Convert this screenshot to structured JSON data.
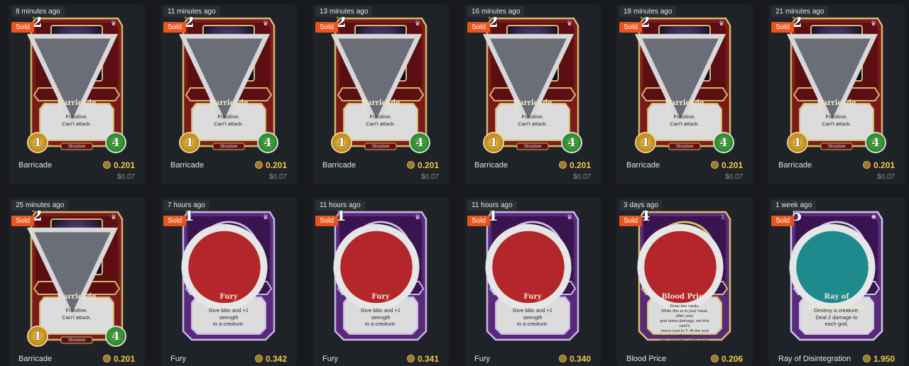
{
  "colors": {
    "page_bg": "#17191c",
    "tile_bg": "#1f2226",
    "sold_badge": "#e8541e",
    "price": "#f2c94c",
    "usd": "#8e8f91"
  },
  "listings": [
    {
      "time": "8 minutes ago",
      "badge": "Sold",
      "card": {
        "name": "Barricade",
        "text": "Frontline.\nCan't attack.",
        "type": "Structure",
        "mana": "2",
        "attack": "1",
        "health": "4",
        "style": "barricade",
        "god_icon": "war-god-icon"
      },
      "name": "Barricade",
      "price": "0.201",
      "usd": "$0.07"
    },
    {
      "time": "11 minutes ago",
      "badge": "Sold",
      "card": {
        "name": "Barricade",
        "text": "Frontline.\nCan't attack.",
        "type": "Structure",
        "mana": "2",
        "attack": "1",
        "health": "4",
        "style": "barricade",
        "god_icon": "war-god-icon"
      },
      "name": "Barricade",
      "price": "0.201",
      "usd": "$0.07"
    },
    {
      "time": "13 minutes ago",
      "badge": "Sold",
      "card": {
        "name": "Barricade",
        "text": "Frontline.\nCan't attack.",
        "type": "Structure",
        "mana": "2",
        "attack": "1",
        "health": "4",
        "style": "barricade",
        "god_icon": "war-god-icon"
      },
      "name": "Barricade",
      "price": "0.201",
      "usd": "$0.07"
    },
    {
      "time": "16 minutes ago",
      "badge": "Sold",
      "card": {
        "name": "Barricade",
        "text": "Frontline.\nCan't attack.",
        "type": "Structure",
        "mana": "2",
        "attack": "1",
        "health": "4",
        "style": "barricade",
        "god_icon": "war-god-icon"
      },
      "name": "Barricade",
      "price": "0.201",
      "usd": "$0.07"
    },
    {
      "time": "18 minutes ago",
      "badge": "Sold",
      "card": {
        "name": "Barricade",
        "text": "Frontline.\nCan't attack.",
        "type": "Structure",
        "mana": "2",
        "attack": "1",
        "health": "4",
        "style": "barricade",
        "god_icon": "war-god-icon"
      },
      "name": "Barricade",
      "price": "0.201",
      "usd": "$0.07"
    },
    {
      "time": "21 minutes ago",
      "badge": "Sold",
      "card": {
        "name": "Barricade",
        "text": "Frontline.\nCan't attack.",
        "type": "Structure",
        "mana": "2",
        "attack": "1",
        "health": "4",
        "style": "barricade",
        "god_icon": "war-god-icon"
      },
      "name": "Barricade",
      "price": "0.201",
      "usd": "$0.07"
    },
    {
      "time": "25 minutes ago",
      "badge": "Sold",
      "card": {
        "name": "Barricade",
        "text": "Frontline.\nCan't attack.",
        "type": "Structure",
        "mana": "2",
        "attack": "1",
        "health": "4",
        "style": "barricade",
        "god_icon": "war-god-icon"
      },
      "name": "Barricade",
      "price": "0.201",
      "usd": ""
    },
    {
      "time": "7 hours ago",
      "badge": "Sold",
      "card": {
        "name": "Fury",
        "text": "Give blitz and +1 strength\nto a creature.",
        "type": "",
        "mana": "1",
        "attack": "",
        "health": "",
        "style": "spell-red",
        "god_icon": "war-god-icon"
      },
      "name": "Fury",
      "price": "0.342",
      "usd": ""
    },
    {
      "time": "11 hours ago",
      "badge": "Sold",
      "card": {
        "name": "Fury",
        "text": "Give blitz and +1 strength\nto a creature.",
        "type": "",
        "mana": "1",
        "attack": "",
        "health": "",
        "style": "spell-red",
        "god_icon": "war-god-icon"
      },
      "name": "Fury",
      "price": "0.341",
      "usd": ""
    },
    {
      "time": "11 hours ago",
      "badge": "Sold",
      "card": {
        "name": "Fury",
        "text": "Give blitz and +1 strength\nto a creature.",
        "type": "",
        "mana": "1",
        "attack": "",
        "health": "",
        "style": "spell-red",
        "god_icon": "war-god-icon"
      },
      "name": "Fury",
      "price": "0.340",
      "usd": ""
    },
    {
      "time": "3 days ago",
      "badge": "Sold",
      "card": {
        "name": "Blood Price",
        "text": "Draw two cards.\nWhile this is in your hand, after your\ngod takes damage, set this card's\nmana cost to 2. At the end of your\nturn, reset this card's mana cost.",
        "type": "",
        "mana": "4",
        "attack": "",
        "health": "",
        "style": "spell-gold",
        "god_icon": "death-god-icon"
      },
      "name": "Blood Price",
      "price": "0.206",
      "usd": ""
    },
    {
      "time": "1 week ago",
      "badge": "Sold",
      "card": {
        "name": "Ray of Disintegration",
        "text": "Destroy a creature.\nDeal 2 damage to\neach god.",
        "type": "",
        "mana": "5",
        "attack": "",
        "health": "",
        "style": "spell-blue",
        "god_icon": "magic-god-icon"
      },
      "name": "Ray of Disintegration",
      "price": "1.950",
      "usd": ""
    }
  ]
}
